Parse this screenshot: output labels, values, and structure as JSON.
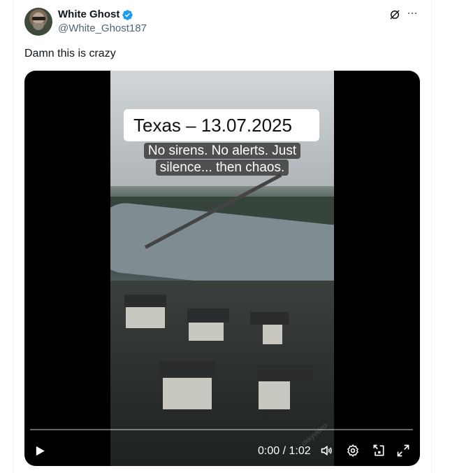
{
  "author": {
    "name": "White Ghost",
    "handle": "@White_Ghost187",
    "verified": true
  },
  "tweet": {
    "text": "Damn this is crazy"
  },
  "video": {
    "title": "Texas – 13.07.2025",
    "caption_line1": "No sirens. No alerts. Just",
    "caption_line2": "silence... then chaos.",
    "watermark": "okkyvideo",
    "time": "0:00 / 1:02",
    "progress": 0
  },
  "icons": {
    "verified": "verified-badge-icon",
    "grok": "grok-icon",
    "more": "more-icon",
    "play": "play-icon",
    "volume": "volume-icon",
    "settings": "settings-icon",
    "pip": "picture-in-picture-icon",
    "fullscreen": "fullscreen-icon"
  },
  "colors": {
    "verified": "#1d9bf0",
    "text": "#0f1419",
    "secondary": "#536471"
  }
}
